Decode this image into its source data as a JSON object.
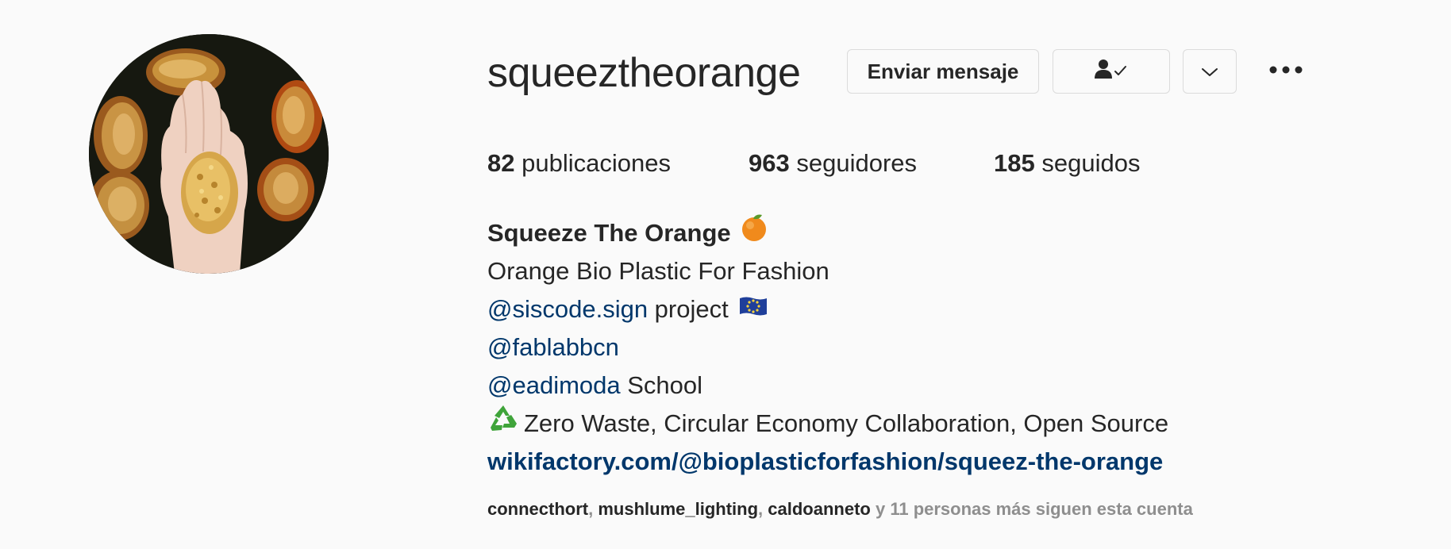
{
  "profile": {
    "username": "squeeztheorange",
    "buttons": {
      "message_label": "Enviar mensaje",
      "following_icon": "person-check-icon",
      "dropdown_icon": "chevron-down-icon",
      "more_icon": "more-horizontal-icon"
    },
    "stats": {
      "posts_count": "82",
      "posts_label": "publicaciones",
      "followers_count": "963",
      "followers_label": "seguidores",
      "following_count": "185",
      "following_label": "seguidos"
    },
    "bio": {
      "name": "Squeeze The Orange",
      "name_emoji": "orange-emoji",
      "tagline": "Orange Bio Plastic For Fashion",
      "mention1": "@siscode.sign",
      "mention1_suffix": " project",
      "mention1_emoji": "eu-flag-emoji",
      "mention2": "@fablabbcn",
      "mention3": "@eadimoda",
      "mention3_suffix": " School",
      "values_emoji": "recycle-emoji",
      "values_text": "Zero Waste, Circular Economy Collaboration, Open Source",
      "website": "wikifactory.com/@bioplasticforfashion/squeez-the-orange"
    },
    "followed_by": {
      "names": [
        "connecthort",
        "mushlume_lighting",
        "caldoanneto"
      ],
      "separator": ", ",
      "suffix": " y 11 personas más siguen esta cuenta"
    },
    "colors": {
      "background": "#fafafa",
      "text": "#262626",
      "link": "#00376b",
      "muted": "#8e8e8e",
      "border": "#dbdbdb"
    }
  }
}
